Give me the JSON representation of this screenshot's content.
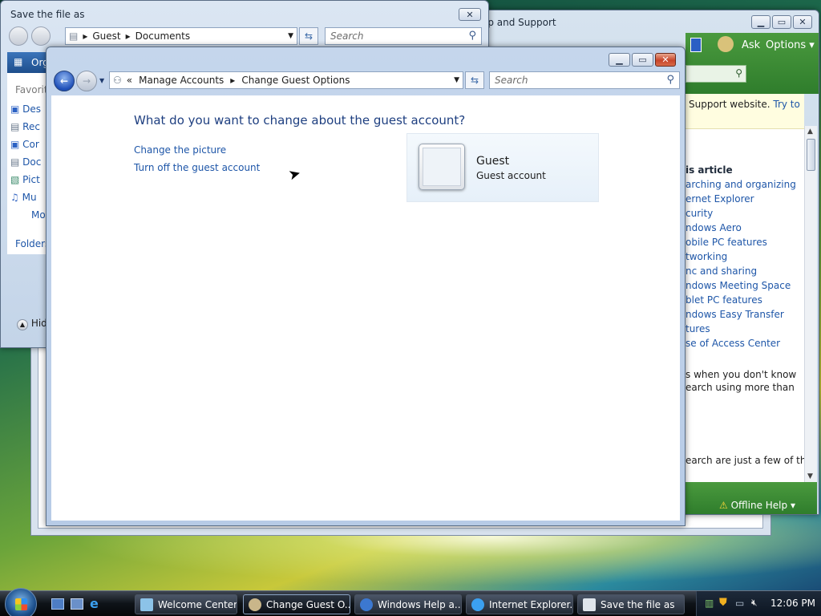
{
  "save_dialog": {
    "title": "Save the file as",
    "breadcrumb": [
      "Guest",
      "Documents"
    ],
    "search_placeholder": "Search",
    "toolbar_organize": "Org",
    "favorites_label": "Favorit",
    "favorites": [
      "Des",
      "Rec",
      "Cor",
      "Doc",
      "Pict",
      "Mu",
      "Mo"
    ],
    "folders_label": "Folders",
    "hide_label": "Hid"
  },
  "help_window": {
    "title": "lp and Support",
    "ask": "Ask",
    "options": "Options",
    "support_text": "Support website.",
    "try_to": "Try to",
    "section_heading": "is article",
    "links": [
      "arching and organizing",
      "ernet Explorer",
      "curity",
      "ndows Aero",
      "obile PC features",
      "tworking",
      "nc and sharing",
      "ndows Meeting Space",
      "blet PC features",
      "ndows Easy Transfer",
      "tures",
      "se of Access Center"
    ],
    "para1_line1": "s when you don't know",
    "para1_line2": "earch using more than",
    "para2": "earch are just a few of the",
    "offline_help": "Offline Help"
  },
  "main_window": {
    "breadcrumb_prefix": "«",
    "breadcrumb": [
      "Manage Accounts",
      "Change Guest Options"
    ],
    "search_placeholder": "Search",
    "question": "What do you want to change about the guest account?",
    "actions": [
      "Change the picture",
      "Turn off the guest account"
    ],
    "account_name": "Guest",
    "account_type": "Guest account"
  },
  "taskbar": {
    "tasks": [
      "Welcome Center",
      "Change Guest O...",
      "Windows Help a...",
      "Internet Explorer...",
      "Save the file as"
    ],
    "clock": "12:06 PM"
  },
  "colors": {
    "link": "#1e56a8",
    "heading": "#1e3f80",
    "help_green": "#3a8a3a"
  }
}
